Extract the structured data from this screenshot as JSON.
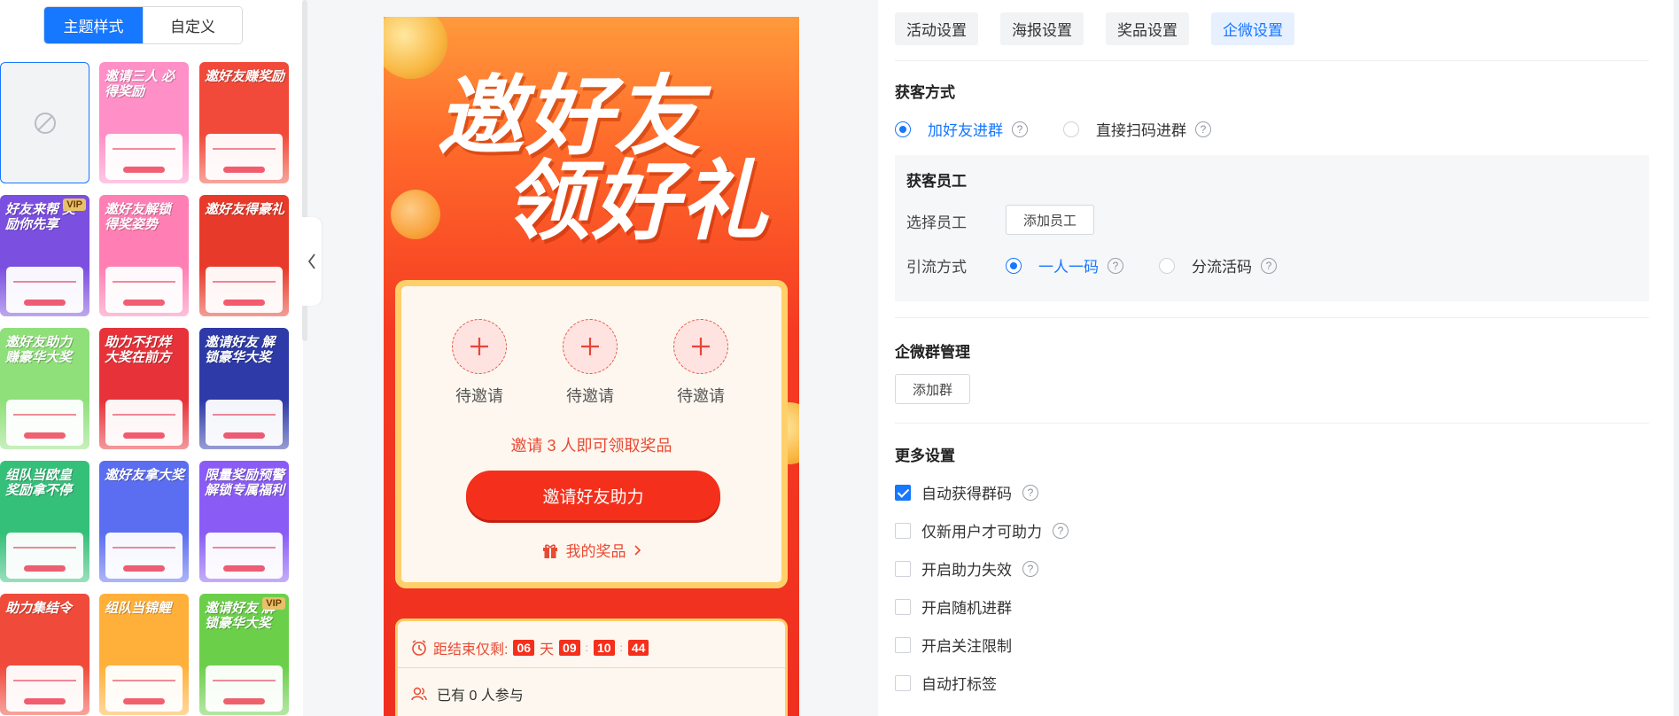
{
  "left": {
    "segment": {
      "active": "主题样式",
      "inactive": "自定义"
    },
    "templates": [
      {
        "title": "",
        "kind": "none"
      },
      {
        "title": "邀请三人 必得奖励",
        "bg": "#ff8fc7",
        "vip": false
      },
      {
        "title": "邀好友赚奖励",
        "bg": "#f14a3a",
        "vip": false
      },
      {
        "title": "好友来帮 奖励你先享",
        "bg": "#7b4fe0",
        "vip": true
      },
      {
        "title": "邀好友解锁 得奖姿势",
        "bg": "#ff7fb4",
        "vip": false
      },
      {
        "title": "邀好友得豪礼",
        "bg": "#e83a2a",
        "vip": false
      },
      {
        "title": "邀好友助力 赚豪华大奖",
        "bg": "#8fe07a",
        "vip": false
      },
      {
        "title": "助力不打烊 大奖在前方",
        "bg": "#e8323a",
        "vip": false
      },
      {
        "title": "邀请好友 解锁豪华大奖",
        "bg": "#2d3aa8",
        "vip": false
      },
      {
        "title": "组队当欧皇 奖励拿不停",
        "bg": "#35c07a",
        "vip": false
      },
      {
        "title": "邀好友拿大奖",
        "bg": "#5b6df0",
        "vip": false
      },
      {
        "title": "限量奖励预警 解锁专属福利",
        "bg": "#8a5cf5",
        "vip": false
      },
      {
        "title": "助力集结令",
        "bg": "#f04a3a",
        "vip": false
      },
      {
        "title": "组队当锦鲤",
        "bg": "#ffb03a",
        "vip": false
      },
      {
        "title": "邀请好友 解锁豪华大奖",
        "bg": "#6ccf4a",
        "vip": true
      }
    ],
    "vip_label": "VIP"
  },
  "preview": {
    "headline_line1": "邀好友",
    "headline_line2": "领好礼",
    "slots": [
      "待邀请",
      "待邀请",
      "待邀请"
    ],
    "hint": "邀请 3 人即可领取奖品",
    "cta": "邀请好友助力",
    "my_prize": "我的奖品",
    "countdown": {
      "label": "距结束仅剩:",
      "days": "06",
      "day_unit": "天",
      "hours": "09",
      "minutes": "10",
      "seconds": "44",
      "sep": ":"
    },
    "participants": "已有 0 人参与"
  },
  "right": {
    "tabs": [
      "活动设置",
      "海报设置",
      "奖品设置",
      "企微设置"
    ],
    "active_tab": 3,
    "acquire": {
      "title": "获客方式",
      "option1": "加好友进群",
      "option2": "直接扫码进群"
    },
    "staff": {
      "title": "获客员工",
      "select_label": "选择员工",
      "add_button": "添加员工",
      "traffic_label": "引流方式",
      "traffic_option1": "一人一码",
      "traffic_option2": "分流活码"
    },
    "group": {
      "title": "企微群管理",
      "add_button": "添加群"
    },
    "more": {
      "title": "更多设置",
      "items": [
        {
          "label": "自动获得群码",
          "checked": true,
          "help": true
        },
        {
          "label": "仅新用户才可助力",
          "checked": false,
          "help": true
        },
        {
          "label": "开启助力失效",
          "checked": false,
          "help": true
        },
        {
          "label": "开启随机进群",
          "checked": false,
          "help": false
        },
        {
          "label": "开启关注限制",
          "checked": false,
          "help": false
        },
        {
          "label": "自动打标签",
          "checked": false,
          "help": false
        }
      ]
    },
    "help_glyph": "?",
    "accent": "#1677ff"
  }
}
